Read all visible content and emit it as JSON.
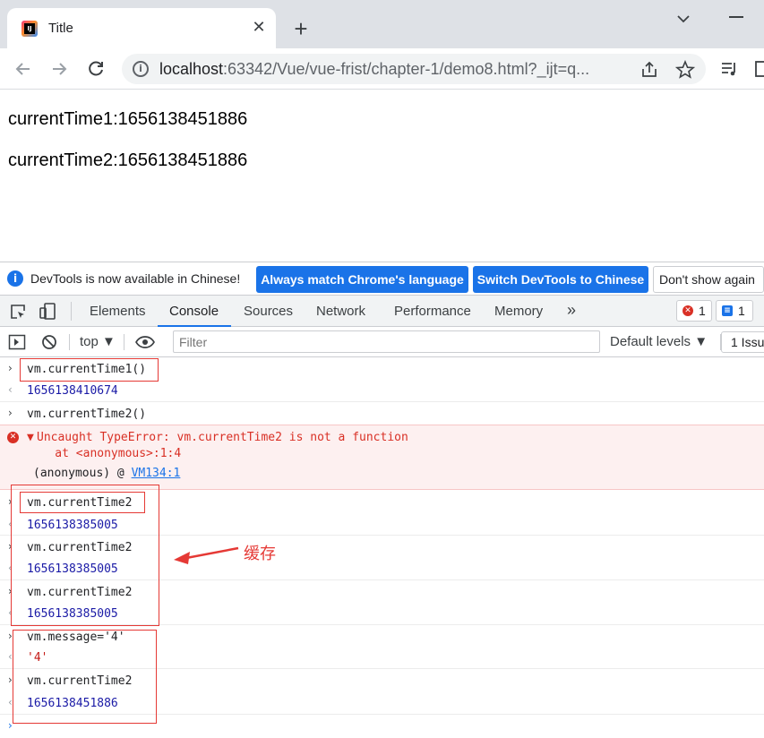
{
  "browser": {
    "tab_title": "Title",
    "tab_close_glyph": "✕",
    "new_tab_glyph": "+",
    "url_host": "localhost",
    "url_rest": ":63342/Vue/vue-frist/chapter-1/demo8.html?_ijt=q...",
    "favicon_text": "IJ"
  },
  "page": {
    "line1": "currentTime1:1656138451886",
    "line2": "currentTime2:1656138451886"
  },
  "devtools": {
    "infobar": {
      "text": "DevTools is now available in Chinese!",
      "btn_match": "Always match Chrome's language",
      "btn_switch": "Switch DevTools to Chinese",
      "btn_dont_show": "Don't show again"
    },
    "tabs": [
      "Elements",
      "Console",
      "Sources",
      "Network",
      "Performance",
      "Memory"
    ],
    "more_tabs_glyph": "»",
    "error_count": "1",
    "message_count": "1",
    "console_bar": {
      "context": "top",
      "filter_placeholder": "Filter",
      "levels": "Default levels",
      "issues": "1 Issu"
    },
    "console": {
      "r1_in": "vm.currentTime1()",
      "r1_out": "1656138410674",
      "r2_in": "vm.currentTime2()",
      "err_line1": "Uncaught TypeError: vm.currentTime2 is not a function",
      "err_line2": "    at <anonymous>:1:4",
      "err_anon": "(anonymous)",
      "err_at": "@",
      "err_link": "VM134:1",
      "r3_in": "vm.currentTime2",
      "r3_out": "1656138385005",
      "r4_in": "vm.currentTime2",
      "r4_out": "1656138385005",
      "r5_in": "vm.currentTime2",
      "r5_out": "1656138385005",
      "r6_in": "vm.message='4'",
      "r6_out": "'4'",
      "r7_in": "vm.currentTime2",
      "r7_out": "1656138451886"
    }
  },
  "annotation": {
    "label": "缓存",
    "color": "#e53935"
  },
  "colors": {
    "accent": "#1a73e8",
    "error": "#d93025",
    "result": "#1a1aa6"
  }
}
